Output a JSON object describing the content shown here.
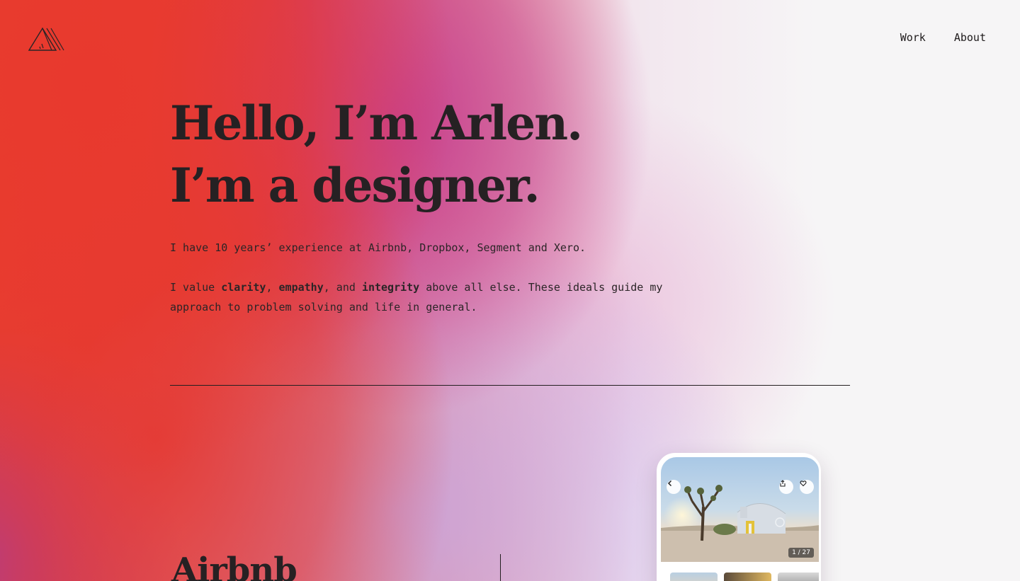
{
  "header": {
    "logo_name": "triangle-mountain-logo",
    "nav": {
      "work": "Work",
      "about": "About"
    }
  },
  "hero": {
    "line1": "Hello, I’m Arlen.",
    "line2": "I’m a designer."
  },
  "intro": {
    "experience": "I have 10 years’ experience at Airbnb, Dropbox, Segment and Xero.",
    "values": {
      "pre": "I value ",
      "v1": "clarity",
      "sep1": ", ",
      "v2": "empathy",
      "sep2": ", and ",
      "v3": "integrity",
      "post": " above all else. These ideals guide my approach to problem solving and life in general."
    }
  },
  "project": {
    "title": "Airbnb",
    "preview": {
      "photo_counter": "1 / 27",
      "icons": [
        "chevron-left-icon",
        "share-icon",
        "heart-icon"
      ]
    }
  },
  "colors": {
    "gradient_red": "#e9472f",
    "gradient_magenta": "#c44096",
    "gradient_lavender": "#c6aae8",
    "background": "#f6f5f6",
    "text": "#262123"
  }
}
